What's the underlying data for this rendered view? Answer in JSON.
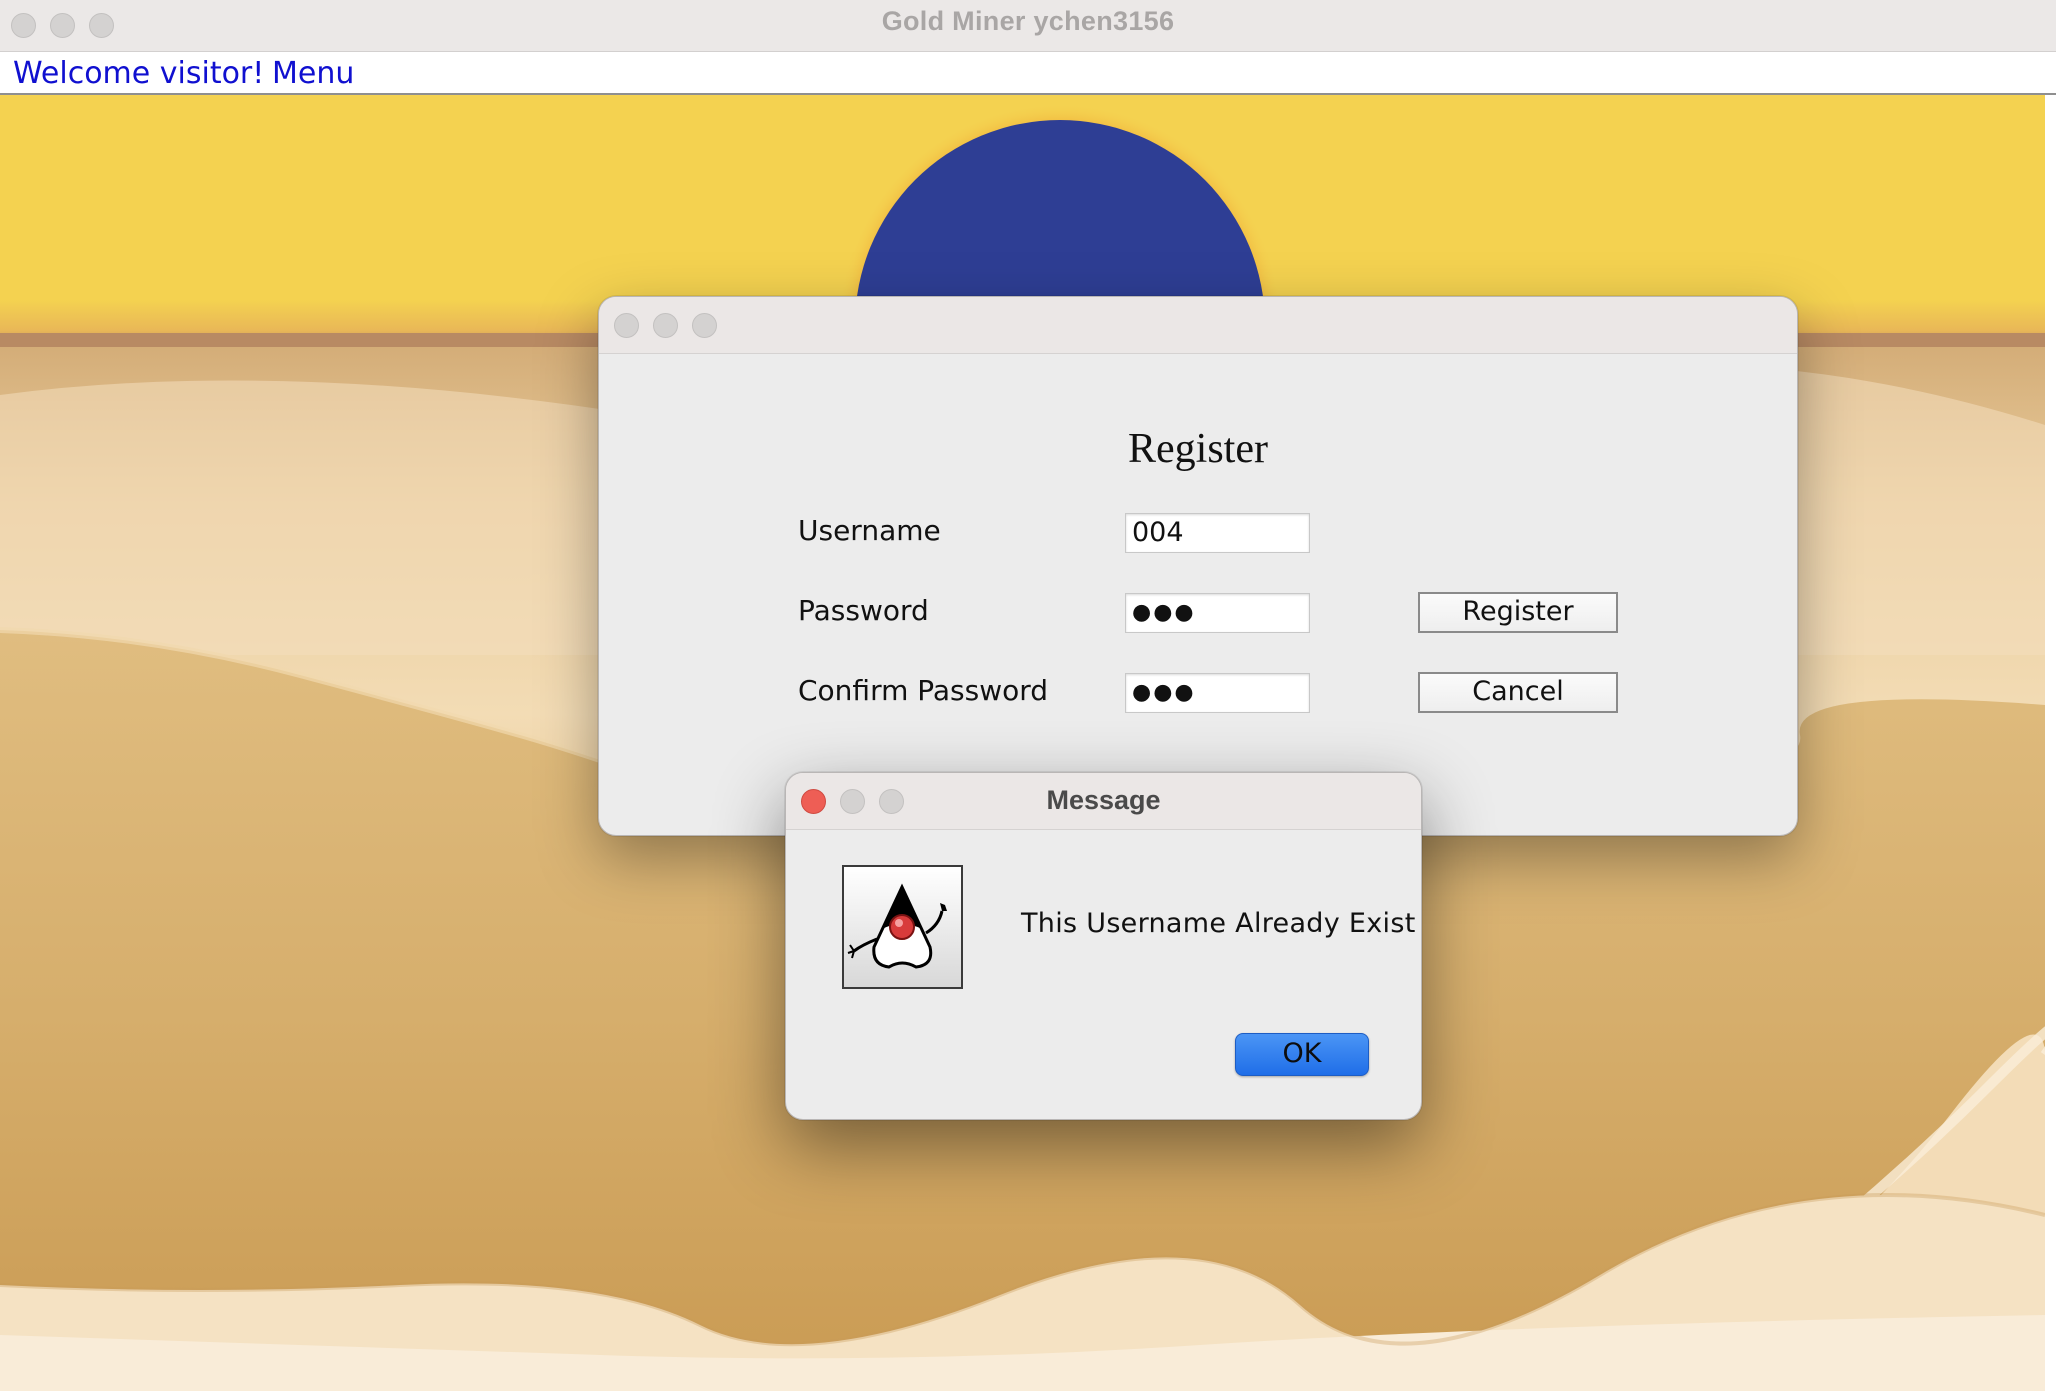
{
  "window": {
    "title": "Gold Miner ychеn3156"
  },
  "menubar": {
    "welcome": "Welcome visitor!",
    "menu": "Menu"
  },
  "scene": {
    "sky_color": "#f4d250",
    "sun_color": "#2e3e94",
    "sand_color": "#d9b272",
    "dune_light_color": "#f6e3c4"
  },
  "register_dialog": {
    "title": "Register",
    "fields": [
      {
        "label": "Username",
        "value": "004"
      },
      {
        "label": "Password",
        "value": "●●●"
      },
      {
        "label": "Confirm Password",
        "value": "●●●"
      }
    ],
    "register_label": "Register",
    "cancel_label": "Cancel"
  },
  "message_dialog": {
    "title": "Message",
    "icon": "java-duke-icon",
    "text": "This Username Already Exist",
    "ok_label": "OK",
    "ok_color": "#2a7bef"
  }
}
